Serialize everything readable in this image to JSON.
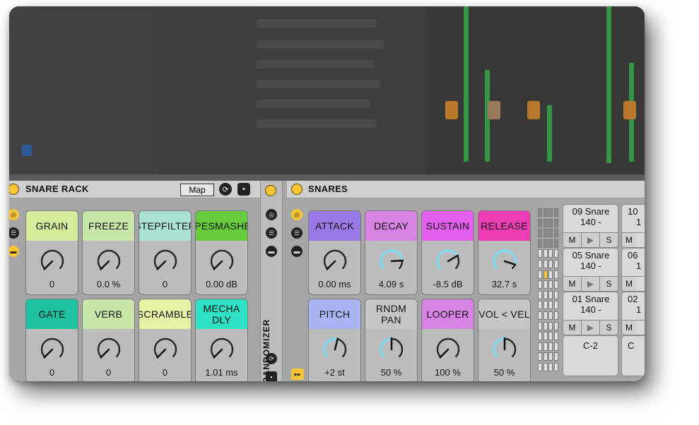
{
  "rack": {
    "title": "SNARE RACK",
    "map_label": "Map",
    "icons": [
      "randomize-icon",
      "save-icon"
    ],
    "macros": [
      {
        "label": "GRAIN",
        "value": "0",
        "color": "#d4ec9b",
        "level": 0.0
      },
      {
        "label": "FREEZE",
        "value": "0.0 %",
        "color": "#c8e6a8",
        "level": 0.0
      },
      {
        "label": "STEPFILTER",
        "value": "0",
        "color": "#a9e2d4",
        "level": 0.0
      },
      {
        "label": "PIPESMASHER",
        "value": "0.00 dB",
        "color": "#66cc3c",
        "level": 0.0
      },
      {
        "label": "GATE",
        "value": "0",
        "color": "#1ec2a0",
        "level": 0.0
      },
      {
        "label": "VERB",
        "value": "0",
        "color": "#c8e6a8",
        "level": 0.0
      },
      {
        "label": "SCRAMBLE",
        "value": "0",
        "color": "#e8f2a6",
        "level": 0.0
      },
      {
        "label": "MECHA DLY",
        "value": "1.01 ms",
        "color": "#2ee0c4",
        "level": 0.0
      }
    ]
  },
  "randomizer": {
    "label": "RANDOMIZER"
  },
  "snares": {
    "title": "SNARES",
    "macros": [
      {
        "label": "ATTACK",
        "value": "0.00 ms",
        "color": "#9a78e6",
        "level": 0.0
      },
      {
        "label": "DECAY",
        "value": "4.09 s",
        "color": "#d882e4",
        "level": 0.82
      },
      {
        "label": "SUSTAIN",
        "value": "-8.5 dB",
        "color": "#e45ef0",
        "level": 0.72
      },
      {
        "label": "RELEASE",
        "value": "32.7 s",
        "color": "#ee3db3",
        "level": 0.9
      },
      {
        "label": "PITCH",
        "value": "+2 st",
        "color": "#a9b5f2",
        "level": 0.55
      },
      {
        "label": "RNDM PAN",
        "value": "50 %",
        "color": "#c6c6c6",
        "level": 0.5
      },
      {
        "label": "LOOPER",
        "value": "100 %",
        "color": "#d882e4",
        "level": 0.0
      },
      {
        "label": "VOL < VEL",
        "value": "50 %",
        "color": "#c6c6c6",
        "level": 0.5
      }
    ],
    "pads": [
      {
        "name": "09 Snare 140 -",
        "m": "M",
        "play": "▶",
        "s": "S"
      },
      {
        "name": "05 Snare 140 -",
        "m": "M",
        "play": "▶",
        "s": "S"
      },
      {
        "name": "01 Snare 140 -",
        "m": "M",
        "play": "▶",
        "s": "S"
      },
      {
        "name": "C-2"
      }
    ],
    "pads_right": [
      {
        "name": "10",
        "sub": "1"
      },
      {
        "name": "06",
        "sub": "1"
      },
      {
        "name": "02",
        "sub": "1"
      },
      {
        "name": "C"
      }
    ]
  },
  "colors": {
    "led": "#f6c633",
    "knob_arc": "#7fd8ef",
    "accent": "#f6c633"
  }
}
